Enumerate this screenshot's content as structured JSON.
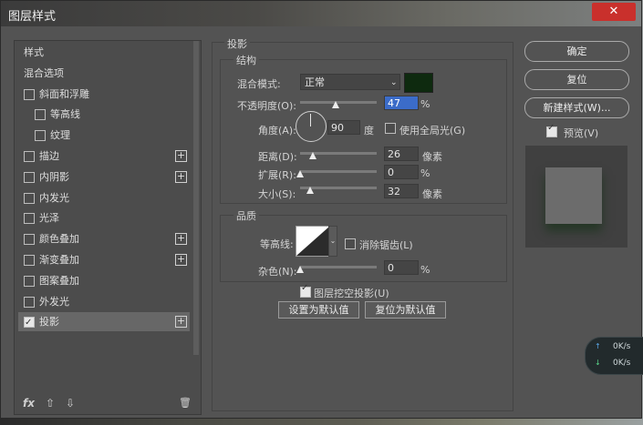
{
  "window": {
    "title": "图层样式",
    "close": "✕"
  },
  "sidebar": {
    "items": [
      {
        "label": "样式",
        "checkbox": false,
        "checked": false,
        "plus": false,
        "indent": 0
      },
      {
        "label": "混合选项",
        "checkbox": false,
        "checked": false,
        "plus": false,
        "indent": 0
      },
      {
        "label": "斜面和浮雕",
        "checkbox": true,
        "checked": false,
        "plus": false,
        "indent": 0
      },
      {
        "label": "等高线",
        "checkbox": true,
        "checked": false,
        "plus": false,
        "indent": 1
      },
      {
        "label": "纹理",
        "checkbox": true,
        "checked": false,
        "plus": false,
        "indent": 1
      },
      {
        "label": "描边",
        "checkbox": true,
        "checked": false,
        "plus": true,
        "indent": 0
      },
      {
        "label": "内阴影",
        "checkbox": true,
        "checked": false,
        "plus": true,
        "indent": 0
      },
      {
        "label": "内发光",
        "checkbox": true,
        "checked": false,
        "plus": false,
        "indent": 0
      },
      {
        "label": "光泽",
        "checkbox": true,
        "checked": false,
        "plus": false,
        "indent": 0
      },
      {
        "label": "颜色叠加",
        "checkbox": true,
        "checked": false,
        "plus": true,
        "indent": 0
      },
      {
        "label": "渐变叠加",
        "checkbox": true,
        "checked": false,
        "plus": true,
        "indent": 0
      },
      {
        "label": "图案叠加",
        "checkbox": true,
        "checked": false,
        "plus": false,
        "indent": 0
      },
      {
        "label": "外发光",
        "checkbox": true,
        "checked": false,
        "plus": false,
        "indent": 0
      },
      {
        "label": "投影",
        "checkbox": true,
        "checked": true,
        "plus": true,
        "indent": 0
      }
    ],
    "selected_index": 13,
    "footer": {
      "fx": "fx",
      "up": "⇧",
      "down": "⇩",
      "trash": "🗑"
    }
  },
  "shadow": {
    "section_title": "投影",
    "structure_title": "结构",
    "blend_mode_label": "混合模式:",
    "blend_mode_value": "正常",
    "color": "#0e2a0f",
    "opacity_label": "不透明度(O):",
    "opacity_value": "47",
    "opacity_fraction": 0.47,
    "unit_percent": "%",
    "angle_label": "角度(A):",
    "angle_value": "90",
    "angle_unit": "度",
    "global_light_label": "使用全局光(G)",
    "global_light_checked": false,
    "distance_label": "距离(D):",
    "distance_value": "26",
    "distance_fraction": 0.17,
    "spread_label": "扩展(R):",
    "spread_value": "0",
    "spread_fraction": 0.0,
    "size_label": "大小(S):",
    "size_value": "32",
    "size_fraction": 0.13,
    "unit_pixel": "像素",
    "quality_title": "品质",
    "contour_label": "等高线:",
    "antialias_label": "消除锯齿(L)",
    "antialias_checked": false,
    "noise_label": "杂色(N):",
    "noise_value": "0",
    "noise_fraction": 0.0,
    "knockout_label": "图层挖空投影(U)",
    "knockout_checked": true,
    "set_default_label": "设置为默认值",
    "reset_default_label": "复位为默认值"
  },
  "buttons": {
    "ok": "确定",
    "reset": "复位",
    "new_style": "新建样式(W)...",
    "preview_label": "预览(V)",
    "preview_checked": true
  },
  "netspeed": {
    "up": "0K/s",
    "down": "0K/s"
  }
}
